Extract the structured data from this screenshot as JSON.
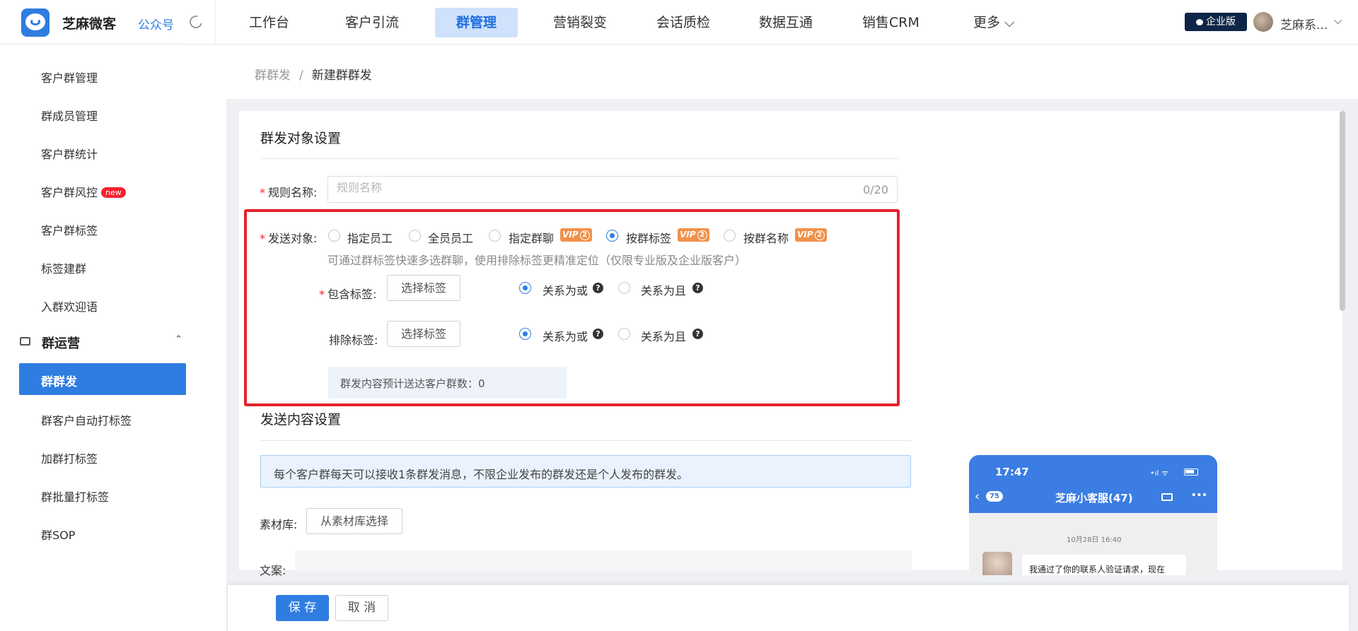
{
  "header": {
    "brand": "芝麻微客",
    "gzh": "公众号",
    "nav": [
      "工作台",
      "客户引流",
      "群管理",
      "营销裂变",
      "会话质检",
      "数据互通",
      "销售CRM",
      "更多 ⌵"
    ],
    "active_nav": "群管理",
    "edition": "企业版",
    "user": "芝麻系...",
    "user_chevron": "⌵"
  },
  "sidebar": {
    "items": [
      "客户群管理",
      "群成员管理",
      "客户群统计",
      "客户群风控",
      "客户群标签",
      "标签建群",
      "入群欢迎语"
    ],
    "new_badge": "new",
    "group": "群运营",
    "group_chevron": "⌃",
    "active": "群群发",
    "sub_items": [
      "群客户自动打标签",
      "加群打标签",
      "群批量打标签",
      "群SOP"
    ]
  },
  "breadcrumb": {
    "parent": "群群发",
    "sep": "/",
    "current": "新建群群发"
  },
  "form": {
    "section1_title": "群发对象设置",
    "rule_name_label": "规则名称:",
    "rule_name_placeholder": "规则名称",
    "rule_name_value": "",
    "rule_name_counter": "0/20",
    "send_target_label": "发送对象:",
    "targets": [
      "指定员工",
      "全员员工",
      "指定群聊",
      "按群标签",
      "按群名称"
    ],
    "selected_target": "按群标签",
    "vip_text": "VIP",
    "vip_num": "2",
    "hint": "可通过群标签快速多选群聊，使用排除标签更精准定位（仅限专业版及企业版客户）",
    "include_label": "包含标签:",
    "exclude_label": "排除标签:",
    "select_tag_btn": "选择标签",
    "relation_or": "关系为或",
    "relation_and": "关系为且",
    "help_glyph": "?",
    "include_relation": "关系为或",
    "exclude_relation": "关系为或",
    "estimate": "群发内容预计送达客户群数：0",
    "section2_title": "发送内容设置",
    "notice": "每个客户群每天可以接收1条群发消息，不限企业发布的群发还是个人发布的群发。",
    "material_label": "素材库:",
    "material_btn": "从素材库选择",
    "copy_label": "文案:"
  },
  "phone": {
    "time": "17:47",
    "signal": "•ıl ᯤ",
    "back": "‹",
    "unread": "75",
    "title": "芝麻小客服(47)",
    "more": "···",
    "date": "10月28日 16:40",
    "message": "我通过了你的联系人验证请求，现在"
  },
  "footer": {
    "save": "保 存",
    "cancel": "取 消"
  }
}
